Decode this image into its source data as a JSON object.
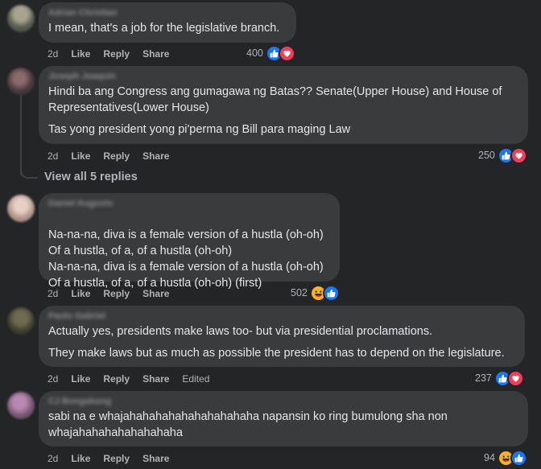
{
  "comments": [
    {
      "author": "Adrian Christian",
      "paragraphs": [
        "I mean, that's a job for the legislative branch."
      ],
      "time": "2d",
      "like": "Like",
      "reply": "Reply",
      "share": "Share",
      "edited": "",
      "reaction_count": "400",
      "reactions": [
        "like",
        "love"
      ]
    },
    {
      "author": "Joseph Joaquin",
      "paragraphs": [
        "Hindi ba ang Congress ang gumagawa ng Batas?? Senate(Upper House) and House of Representatives(Lower House)",
        "Tas yong president yong pi'perma ng Bill para maging Law"
      ],
      "time": "2d",
      "like": "Like",
      "reply": "Reply",
      "share": "Share",
      "edited": "",
      "reaction_count": "250",
      "reactions": [
        "like",
        "love"
      ]
    },
    {
      "author": "Daniel Augusto",
      "paragraphs": [
        "Na-na-na, diva is a female version of a hustla (oh-oh)\nOf a hustla, of a, of a hustla (oh-oh)\nNa-na-na, diva is a female version of a hustla (oh-oh)\nOf a hustla, of a, of a hustla (oh-oh) (first)"
      ],
      "time": "2d",
      "like": "Like",
      "reply": "Reply",
      "share": "Share",
      "edited": "",
      "reaction_count": "502",
      "reactions": [
        "haha",
        "like"
      ]
    },
    {
      "author": "Paolo Gabriel",
      "paragraphs": [
        "Actually yes, presidents make laws too- but via presidential proclamations.",
        "They make laws but as much as possible the president has to depend on the legislature."
      ],
      "time": "2d",
      "like": "Like",
      "reply": "Reply",
      "share": "Share",
      "edited": "Edited",
      "reaction_count": "237",
      "reactions": [
        "like",
        "love"
      ]
    },
    {
      "author": "CJ Bongabong",
      "paragraphs": [
        "sabi na e whajahahahahahahahahahaha napansin ko ring bumulong sha non whajahahahahahahahaha"
      ],
      "time": "2d",
      "like": "Like",
      "reply": "Reply",
      "share": "Share",
      "edited": "",
      "reaction_count": "94",
      "reactions": [
        "haha",
        "like"
      ]
    }
  ],
  "view_replies": "View all 5 replies",
  "colors": {
    "background": "#242526",
    "bubble": "#3a3b3c",
    "text": "#e4e6eb",
    "secondary": "#b0b3b8",
    "like": "#1877f2",
    "love": "#f33e58",
    "haha": "#f7b125"
  }
}
